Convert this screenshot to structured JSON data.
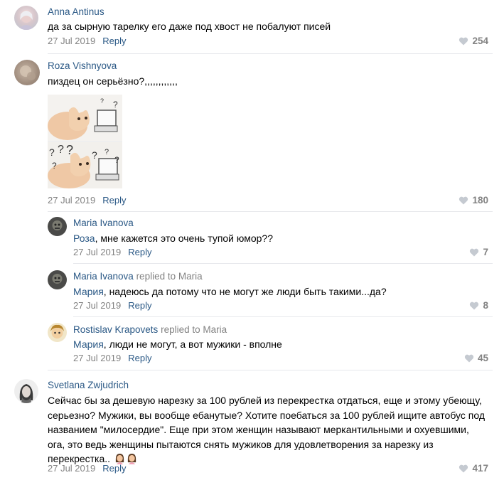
{
  "comments": [
    {
      "author": "Anna Antinus",
      "text": "да за сырную тарелку его даже под хвост не побалуют писей",
      "date": "27 Jul 2019",
      "reply_label": "Reply",
      "likes": "254"
    },
    {
      "author": "Roza Vishnyova",
      "text": "пиздец он серьёзно?,,,,,,,,,,,,",
      "date": "27 Jul 2019",
      "reply_label": "Reply",
      "likes": "180"
    },
    {
      "author": "Maria Ivanova",
      "mention": "Роза",
      "text": ", мне кажется это очень тупой юмор??",
      "date": "27 Jul 2019",
      "reply_label": "Reply",
      "likes": "7"
    },
    {
      "author": "Maria Ivanova",
      "replied_to": "replied to Maria",
      "mention": "Мария",
      "text": ", надеюсь да потому что не могут же люди быть такими...да?",
      "date": "27 Jul 2019",
      "reply_label": "Reply",
      "likes": "8"
    },
    {
      "author": "Rostislav Krapovets",
      "replied_to": "replied to Maria",
      "mention": "Мария",
      "text": ", люди не могут, а вот мужики - вполне",
      "date": "27 Jul 2019",
      "reply_label": "Reply",
      "likes": "45"
    },
    {
      "author": "Svetlana Zwjudrich",
      "lines": [
        "Сейчас бы за дешевую нарезку за 100 рублей из перекрестка отдаться, еще и этому убеющу,",
        "серьезно? Мужики, вы вообще ебанутые? Хотите поебаться за 100 рублей ищите автобус под",
        "названием \"милосердие\". Еще при этом женщин называют меркантильными и охуевшими,",
        "ога, это ведь женщины пытаются снять мужиков для удовлетворения за нарезку из",
        "перекрестка.."
      ],
      "date": "27 Jul 2019",
      "reply_label": "Reply",
      "likes": "417"
    }
  ],
  "icons": {
    "like": "heart-icon",
    "emoji": "woman-emoji-icon"
  },
  "colors": {
    "link": "#2a5885",
    "meta": "#828282",
    "separator": "#e7e8ec"
  }
}
